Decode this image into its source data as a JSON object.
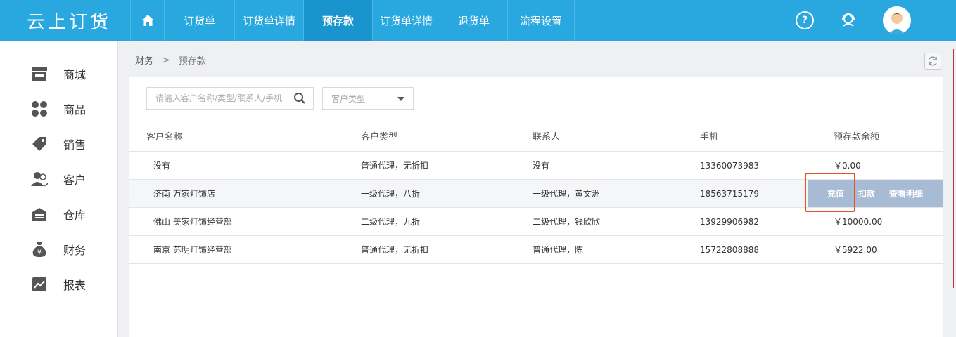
{
  "app": {
    "logo": "云上订货"
  },
  "nav": {
    "items": [
      {
        "label": "订货单",
        "width": 100
      },
      {
        "label": "订货单详情",
        "width": 98
      },
      {
        "label": "预存款",
        "width": 98,
        "active": true
      },
      {
        "label": "订货单详情",
        "width": 96
      },
      {
        "label": "退货单",
        "width": 96
      },
      {
        "label": "流程设置",
        "width": 96
      }
    ],
    "help_icon": "?"
  },
  "sidebar": {
    "items": [
      {
        "label": "商城",
        "icon": "store-icon"
      },
      {
        "label": "商品",
        "icon": "grid-icon"
      },
      {
        "label": "销售",
        "icon": "tag-icon"
      },
      {
        "label": "客户",
        "icon": "users-icon"
      },
      {
        "label": "仓库",
        "icon": "warehouse-icon"
      },
      {
        "label": "财务",
        "icon": "money-bag-icon"
      },
      {
        "label": "报表",
        "icon": "chart-icon"
      }
    ]
  },
  "breadcrumb": {
    "parent": "财务",
    "separator": ">",
    "current": "预存款"
  },
  "search": {
    "placeholder": "请输入客户名称/类型/联系人/手机",
    "value": ""
  },
  "filter": {
    "placeholder": "客户类型"
  },
  "table": {
    "headers": [
      "客户名称",
      "客户类型",
      "联系人",
      "手机",
      "预存款余额"
    ],
    "rows": [
      [
        "没有",
        "普通代理，无折扣",
        "没有",
        "13360073983",
        "￥0.00"
      ],
      [
        "济南 万家灯饰店",
        "一级代理，八折",
        "一级代理，黄文洲",
        "18563715179",
        ""
      ],
      [
        "佛山 美家灯饰经营部",
        "二级代理，九折",
        "二级代理，钱欣欣",
        "13929906982",
        "￥10000.00"
      ],
      [
        "南京 苏明灯饰经营部",
        "普通代理，无折扣",
        "普通代理，陈",
        "15722808888",
        "￥5922.00"
      ]
    ]
  },
  "row_actions": {
    "recharge": "充值",
    "deduct": "扣款",
    "details": "查看明细"
  },
  "colors": {
    "primary": "#29a8e0",
    "active_nav": "#1a94cc",
    "action_bg": "#a8bbd4",
    "highlight": "#e6531f"
  }
}
